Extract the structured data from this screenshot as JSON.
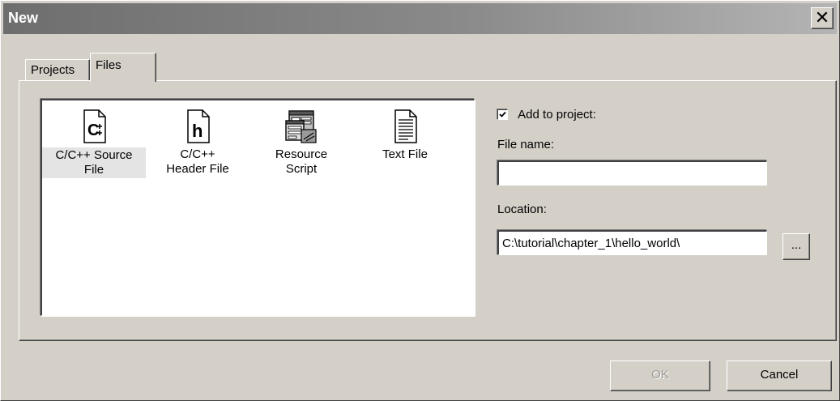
{
  "window": {
    "title": "New",
    "close_glyph": "✕"
  },
  "tabs": [
    {
      "label": "Projects",
      "active": false
    },
    {
      "label": "Files",
      "active": true
    }
  ],
  "file_types": [
    {
      "label": "C/C++ Source\nFile",
      "icon": "cpp-source-file-icon",
      "selected": true
    },
    {
      "label": "C/C++\nHeader File",
      "icon": "header-file-icon",
      "selected": false
    },
    {
      "label": "Resource\nScript",
      "icon": "resource-script-icon",
      "selected": false
    },
    {
      "label": "Text File",
      "icon": "text-file-icon",
      "selected": false
    }
  ],
  "options": {
    "add_to_project_label": "Add to project:",
    "add_to_project_checked": true,
    "file_name_label": "File name:",
    "file_name_value": "",
    "location_label": "Location:",
    "location_value": "C:\\tutorial\\chapter_1\\hello_world\\",
    "browse_label": "..."
  },
  "buttons": {
    "ok_label": "OK",
    "ok_enabled": false,
    "cancel_label": "Cancel"
  },
  "icon_glyphs": {
    "source": "C",
    "header": "h"
  }
}
